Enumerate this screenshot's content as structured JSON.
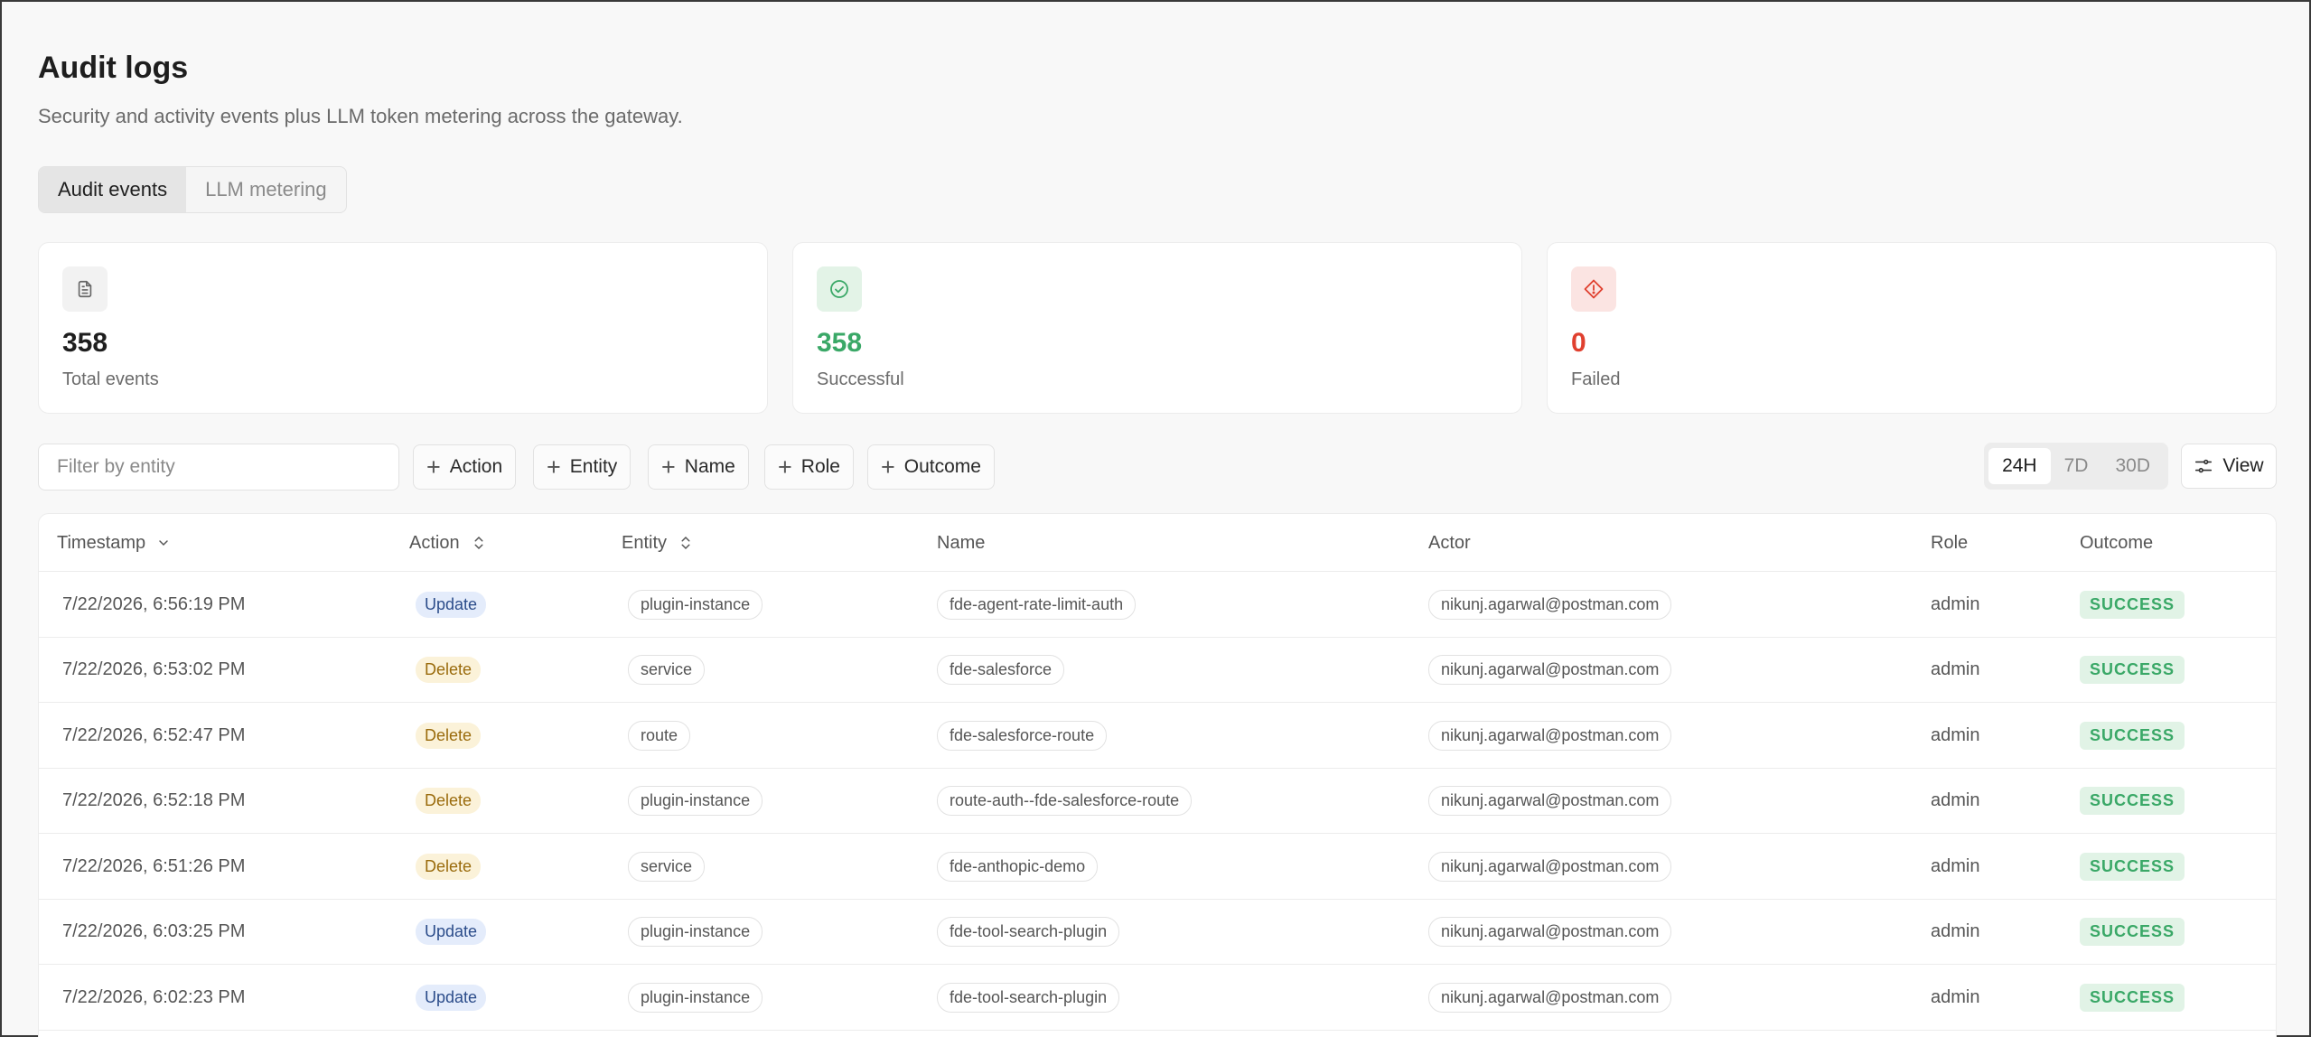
{
  "header": {
    "title": "Audit logs",
    "subtitle": "Security and activity events plus LLM token metering across the gateway."
  },
  "tabs": [
    {
      "label": "Audit events",
      "active": true
    },
    {
      "label": "LLM metering",
      "active": false
    }
  ],
  "stats": [
    {
      "icon": "document-icon",
      "value": "358",
      "label": "Total events",
      "color": "#1e1e1e"
    },
    {
      "icon": "check-circle-icon",
      "value": "358",
      "label": "Successful",
      "color": "#3aa867"
    },
    {
      "icon": "alert-diamond-icon",
      "value": "0",
      "label": "Failed",
      "color": "#e0402f"
    }
  ],
  "filters": {
    "search_placeholder": "Filter by entity",
    "chips": [
      "Action",
      "Entity",
      "Name",
      "Role",
      "Outcome"
    ]
  },
  "time_range": {
    "options": [
      "24H",
      "7D",
      "30D"
    ],
    "selected": "24H"
  },
  "view_label": "View",
  "table": {
    "columns": [
      "Timestamp",
      "Action",
      "Entity",
      "Name",
      "Actor",
      "Role",
      "Outcome"
    ],
    "rows": [
      {
        "timestamp": "7/22/2026, 6:56:19 PM",
        "action": "Update",
        "entity": "plugin-instance",
        "name": "fde-agent-rate-limit-auth",
        "actor": "nikunj.agarwal@postman.com",
        "role": "admin",
        "outcome": "SUCCESS"
      },
      {
        "timestamp": "7/22/2026, 6:53:02 PM",
        "action": "Delete",
        "entity": "service",
        "name": "fde-salesforce",
        "actor": "nikunj.agarwal@postman.com",
        "role": "admin",
        "outcome": "SUCCESS"
      },
      {
        "timestamp": "7/22/2026, 6:52:47 PM",
        "action": "Delete",
        "entity": "route",
        "name": "fde-salesforce-route",
        "actor": "nikunj.agarwal@postman.com",
        "role": "admin",
        "outcome": "SUCCESS"
      },
      {
        "timestamp": "7/22/2026, 6:52:18 PM",
        "action": "Delete",
        "entity": "plugin-instance",
        "name": "route-auth--fde-salesforce-route",
        "actor": "nikunj.agarwal@postman.com",
        "role": "admin",
        "outcome": "SUCCESS"
      },
      {
        "timestamp": "7/22/2026, 6:51:26 PM",
        "action": "Delete",
        "entity": "service",
        "name": "fde-anthopic-demo",
        "actor": "nikunj.agarwal@postman.com",
        "role": "admin",
        "outcome": "SUCCESS"
      },
      {
        "timestamp": "7/22/2026, 6:03:25 PM",
        "action": "Update",
        "entity": "plugin-instance",
        "name": "fde-tool-search-plugin",
        "actor": "nikunj.agarwal@postman.com",
        "role": "admin",
        "outcome": "SUCCESS"
      },
      {
        "timestamp": "7/22/2026, 6:02:23 PM",
        "action": "Update",
        "entity": "plugin-instance",
        "name": "fde-tool-search-plugin",
        "actor": "nikunj.agarwal@postman.com",
        "role": "admin",
        "outcome": "SUCCESS"
      }
    ]
  }
}
